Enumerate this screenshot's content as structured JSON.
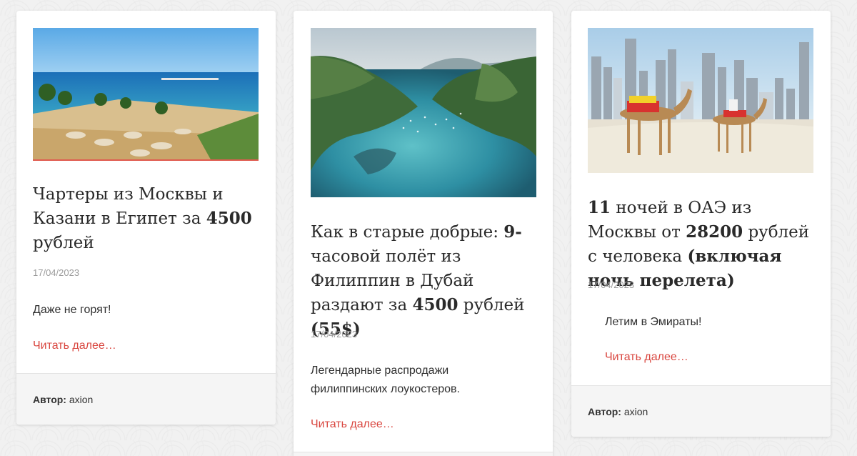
{
  "cards": [
    {
      "title_parts": [
        "Чартеры из Москвы и Казани в Египет за ",
        "4500",
        " рублей"
      ],
      "date": "17/04/2023",
      "desc": "Даже не горят!",
      "more": "Читать далее…",
      "author_label": "Автор:",
      "author": "axion",
      "image": "beach-resort-egypt"
    },
    {
      "title_parts": [
        "Как в старые добрые: ",
        "9-",
        "часовой полёт из Филиппин в Дубай раздают за ",
        "4500",
        " рублей ",
        "(55$)"
      ],
      "date": "17/04/2023",
      "desc": "Легендарные распродажи филиппинских лоукостеров.",
      "more": "Читать далее…",
      "image": "tropical-bay-philippines"
    },
    {
      "title_parts": [
        "11",
        " ночей в ОАЭ из Москвы от ",
        "28200",
        " рублей с человека ",
        "(включая ночь перелета)"
      ],
      "date": "17/04/2023",
      "desc": "Летим в Эмираты!",
      "more": "Читать далее…",
      "author_label": "Автор:",
      "author": "axion",
      "image": "camels-dubai-skyline"
    }
  ]
}
